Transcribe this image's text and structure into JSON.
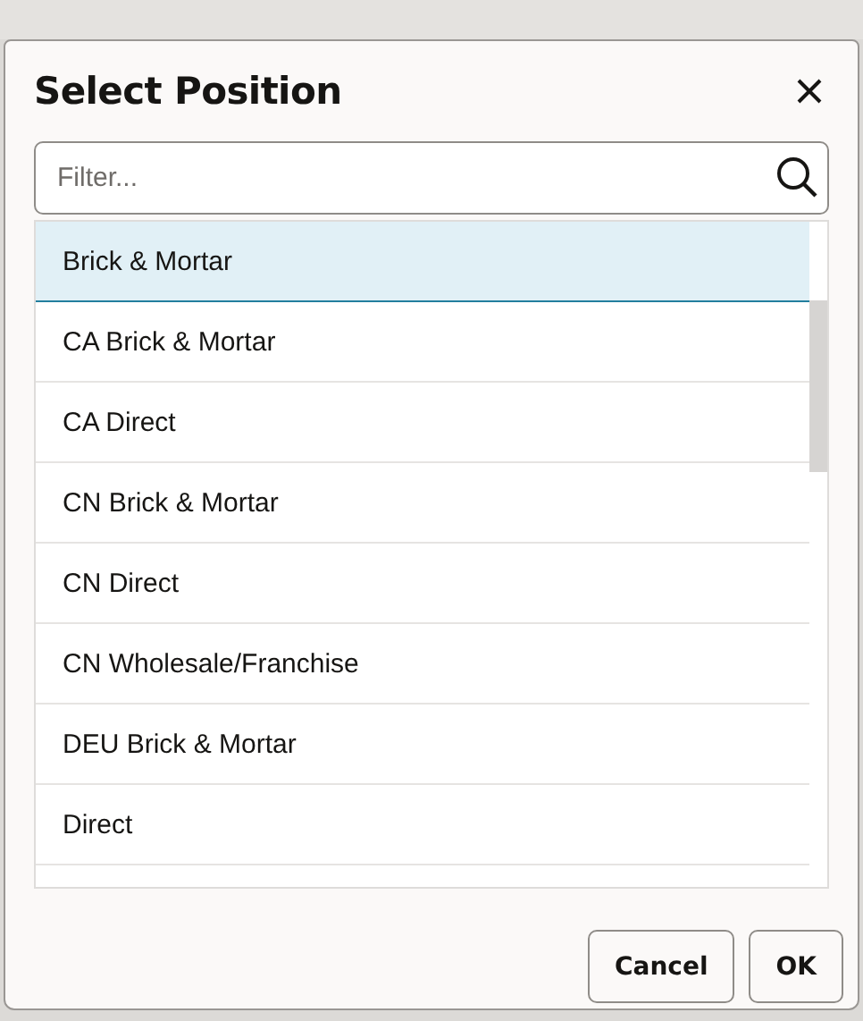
{
  "dialog": {
    "title": "Select Position"
  },
  "filter": {
    "placeholder": "Filter..."
  },
  "items": [
    {
      "label": "Brick & Mortar",
      "selected": true
    },
    {
      "label": "CA Brick & Mortar",
      "selected": false
    },
    {
      "label": "CA Direct",
      "selected": false
    },
    {
      "label": "CN Brick & Mortar",
      "selected": false
    },
    {
      "label": "CN Direct",
      "selected": false
    },
    {
      "label": "CN Wholesale/Franchise",
      "selected": false
    },
    {
      "label": "DEU Brick & Mortar",
      "selected": false
    },
    {
      "label": "Direct",
      "selected": false
    }
  ],
  "buttons": [
    {
      "label": "Cancel"
    },
    {
      "label": "OK"
    }
  ]
}
